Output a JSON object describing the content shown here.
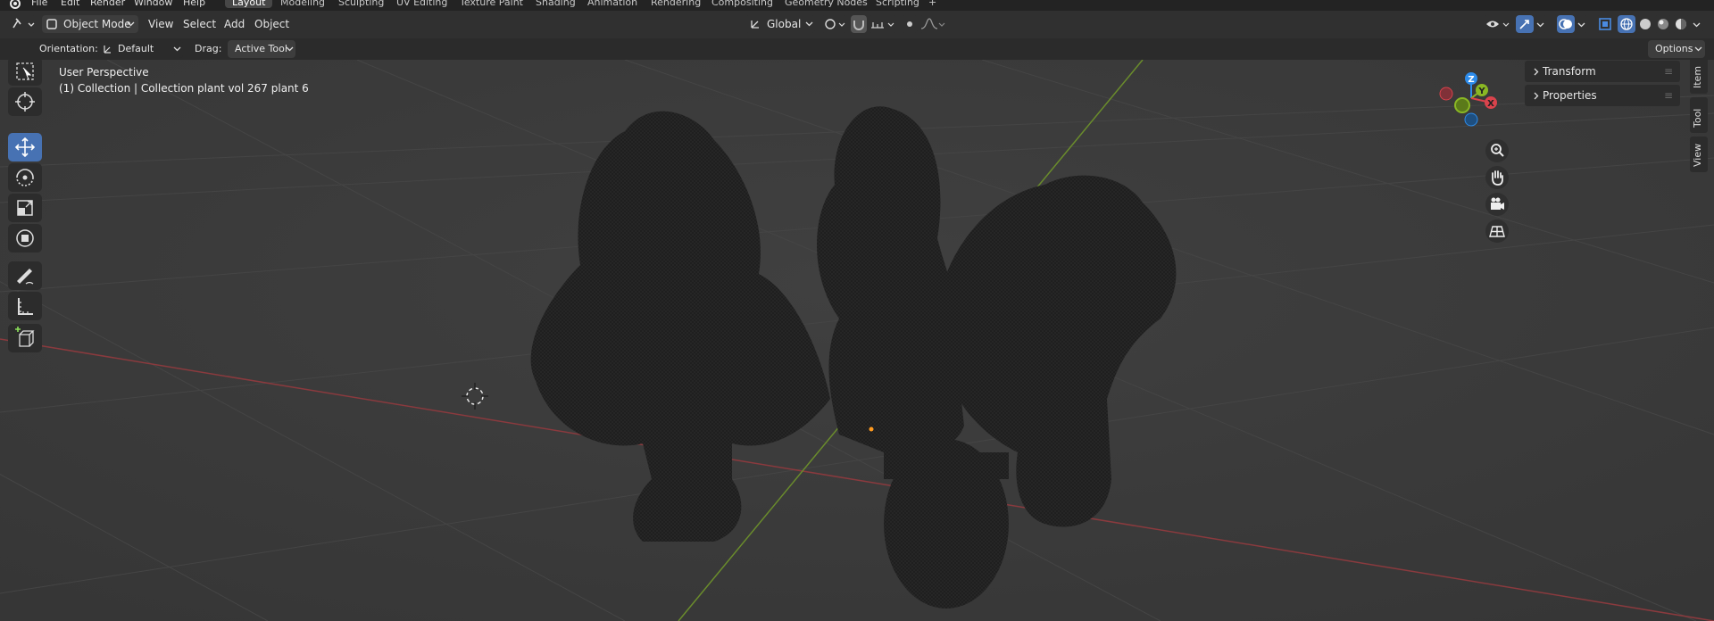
{
  "topbar": {
    "menus": [
      "File",
      "Edit",
      "Render",
      "Window",
      "Help"
    ],
    "workspaces": [
      "Layout",
      "Modeling",
      "Sculpting",
      "UV Editing",
      "Texture Paint",
      "Shading",
      "Animation",
      "Rendering",
      "Compositing",
      "Geometry Nodes",
      "Scripting"
    ],
    "add_tab": "+"
  },
  "header": {
    "mode": "Object Mode",
    "menus": [
      "View",
      "Select",
      "Add",
      "Object"
    ],
    "transform_orientation": "Global"
  },
  "tool_settings": {
    "orientation_label": "Orientation:",
    "orientation_value": "Default",
    "drag_label": "Drag:",
    "drag_value": "Active Tool",
    "options": "Options"
  },
  "viewport": {
    "perspective": "User Perspective",
    "collection": "(1) Collection | Collection plant vol 267 plant 6"
  },
  "sidebar": {
    "panels": [
      "Transform",
      "Properties"
    ],
    "tabs": [
      "Item",
      "Tool",
      "View"
    ]
  },
  "gizmo": {
    "z": "Z",
    "y": "Y",
    "x": "X"
  },
  "colors": {
    "accent": "#4772b3",
    "x_axis": "#d9434c",
    "y_axis": "#8ab724",
    "z_axis": "#2d8ceb"
  }
}
